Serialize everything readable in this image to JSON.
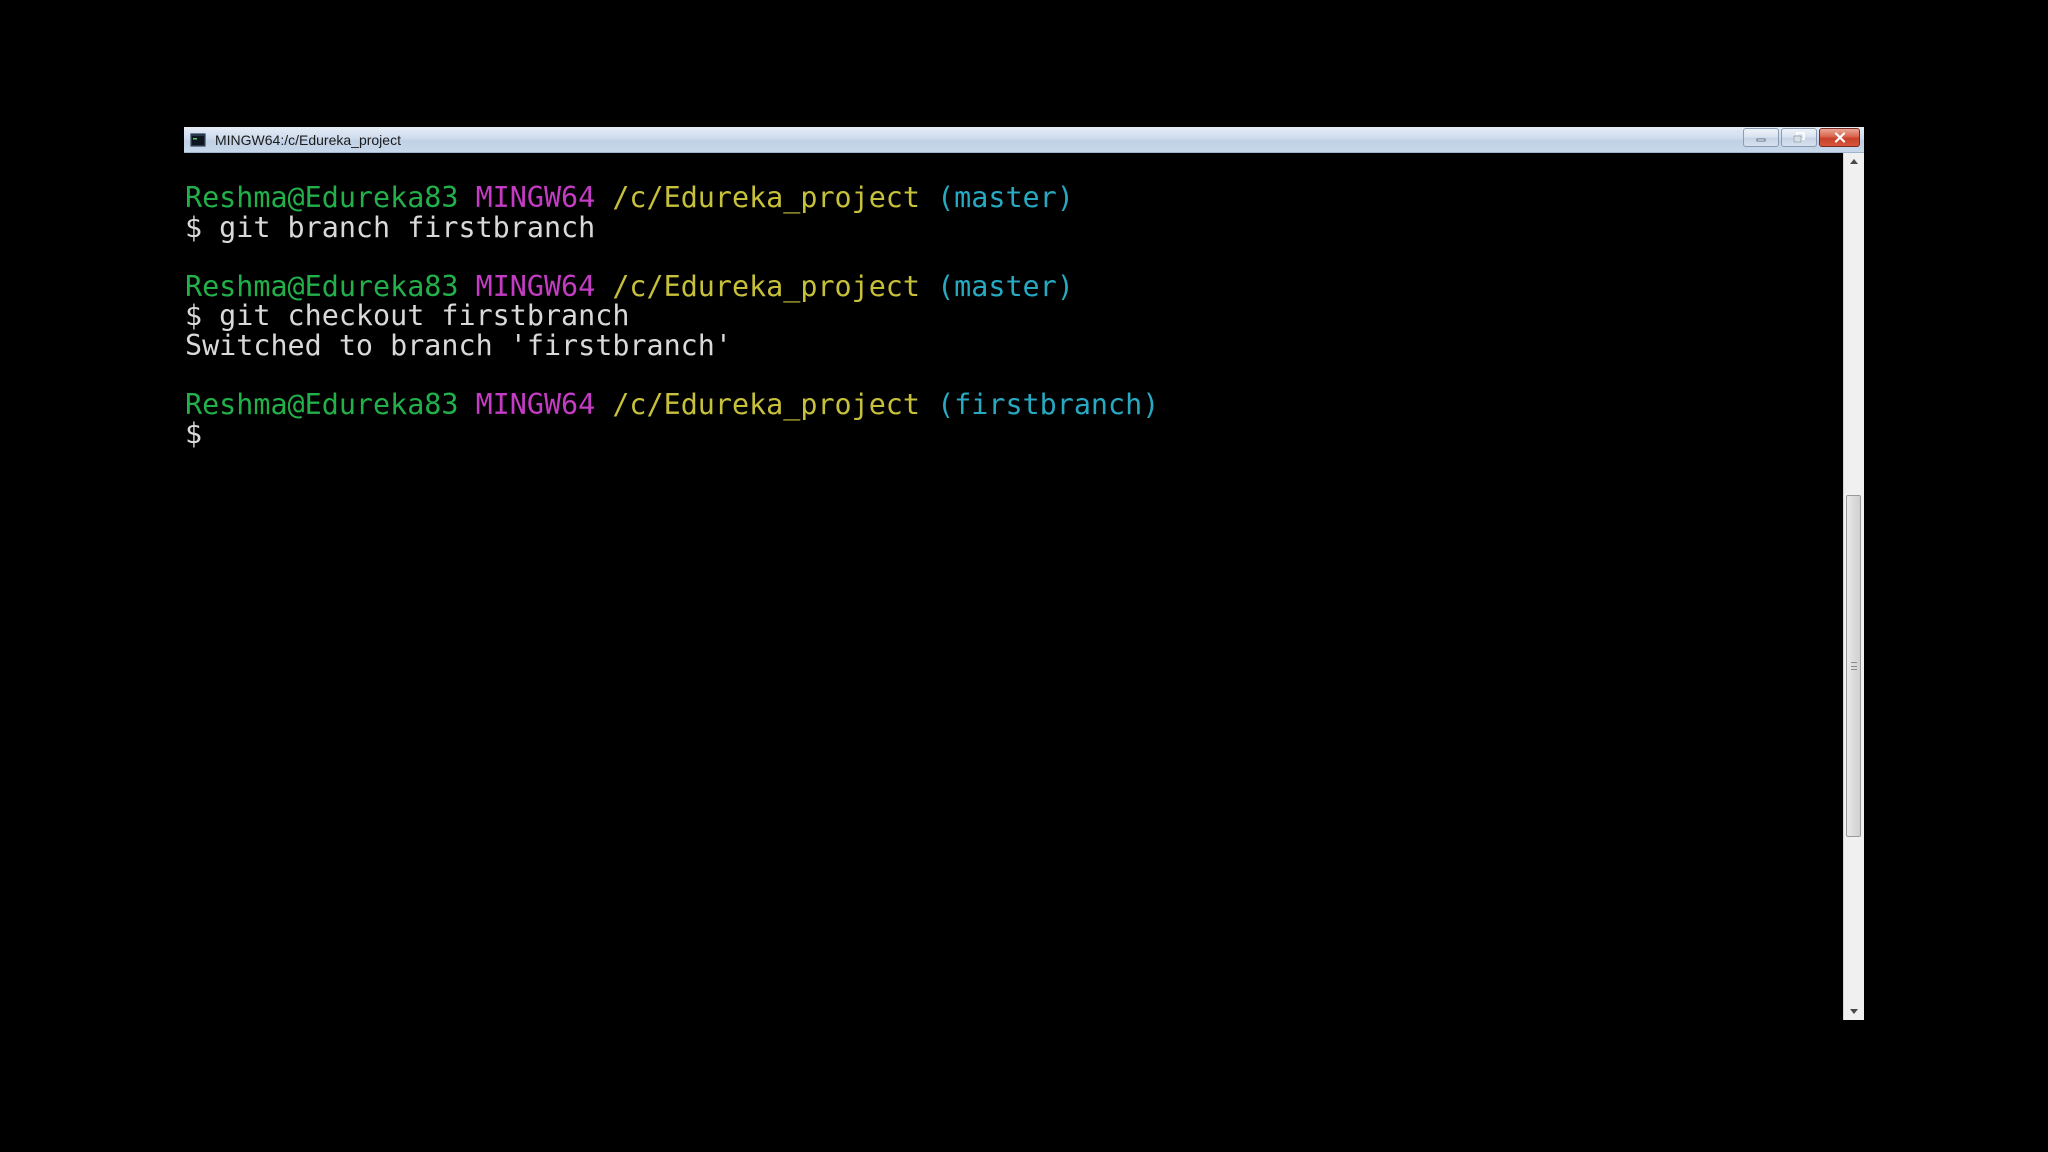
{
  "window": {
    "title": "MINGW64:/c/Edureka_project",
    "controls": {
      "minimize_icon": "minimize-icon",
      "restore_icon": "restore-icon",
      "close_icon": "close-icon"
    }
  },
  "terminal": {
    "colors": {
      "background": "#000000",
      "user_host": "#22b04a",
      "system": "#c43cc4",
      "path": "#c7c03a",
      "branch": "#27a9c2",
      "output": "#d9d9d9"
    },
    "lines": [
      {
        "type": "prompt",
        "user_host": "Reshma@Edureka83",
        "system": "MINGW64",
        "path": "/c/Edureka_project",
        "branch": "(master)"
      },
      {
        "type": "command",
        "text": "$ git branch firstbranch"
      },
      {
        "type": "blank"
      },
      {
        "type": "prompt",
        "user_host": "Reshma@Edureka83",
        "system": "MINGW64",
        "path": "/c/Edureka_project",
        "branch": "(master)"
      },
      {
        "type": "command",
        "text": "$ git checkout firstbranch"
      },
      {
        "type": "output",
        "text": "Switched to branch 'firstbranch'"
      },
      {
        "type": "blank"
      },
      {
        "type": "prompt",
        "user_host": "Reshma@Edureka83",
        "system": "MINGW64",
        "path": "/c/Edureka_project",
        "branch": "(firstbranch)"
      },
      {
        "type": "command",
        "text": "$"
      }
    ]
  },
  "scrollbar": {
    "position_fraction": 0.39,
    "visible_fraction": 0.41,
    "up_icon": "scroll-up-arrow-icon",
    "down_icon": "scroll-down-arrow-icon"
  }
}
